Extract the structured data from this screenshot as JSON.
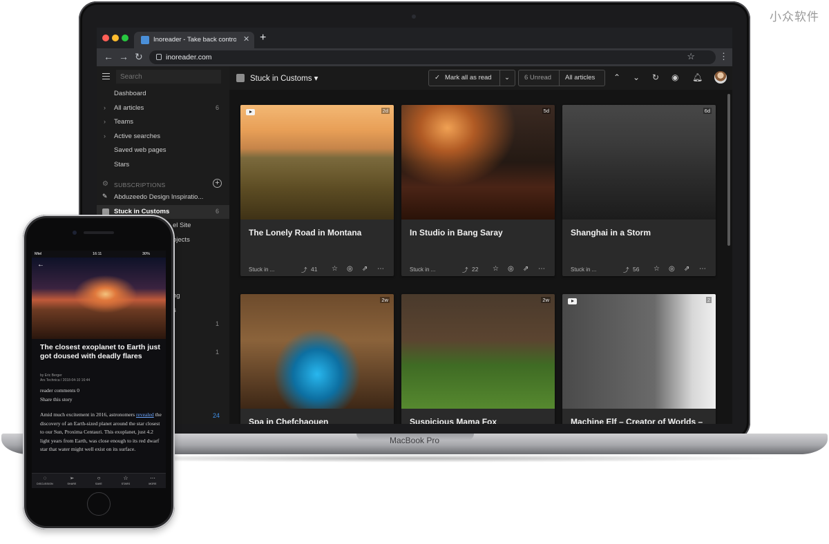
{
  "watermark": "小众软件",
  "laptop": {
    "brand": "MacBook Pro",
    "browser": {
      "tab_title": "Inoreader - Take back control o",
      "url": "inoreader.com"
    },
    "sidebar": {
      "search_placeholder": "Search",
      "nav": [
        {
          "label": "Dashboard",
          "count": ""
        },
        {
          "label": "All articles",
          "count": "6"
        },
        {
          "label": "Teams",
          "count": ""
        },
        {
          "label": "Active searches",
          "count": ""
        },
        {
          "label": "Saved web pages",
          "count": ""
        },
        {
          "label": "Stars",
          "count": ""
        }
      ],
      "subscriptions_heading": "SUBSCRIPTIONS",
      "feeds": [
        {
          "label": "Abduzeedo Design Inspiratio...",
          "count": ""
        },
        {
          "label": "Stuck in Customs",
          "count": "6"
        },
        {
          "label": "el Site",
          "count": ""
        },
        {
          "label": "ojects",
          "count": ""
        },
        {
          "label": "ng",
          "count": ""
        },
        {
          "label": "s",
          "count": ""
        }
      ],
      "extra_counts": [
        "1",
        "1",
        "24"
      ]
    },
    "topbar": {
      "feed_title": "Stuck in Customs ▾",
      "mark_all_read": "Mark all as read",
      "unread": "6 Unread",
      "all_articles": "All articles"
    },
    "cards": [
      {
        "title": "The Lonely Road in Montana",
        "age": "2d",
        "source": "Stuck in ...",
        "popularity": "41",
        "video": true
      },
      {
        "title": "In Studio in Bang Saray",
        "age": "5d",
        "source": "Stuck in ...",
        "popularity": "22",
        "video": false
      },
      {
        "title": "Shanghai in a Storm",
        "age": "6d",
        "source": "Stuck in ...",
        "popularity": "56",
        "video": false
      },
      {
        "title": "Spa in Chefchaouen",
        "age": "2w",
        "source": "",
        "popularity": "",
        "video": false
      },
      {
        "title": "Suspicious Mama Fox",
        "age": "2w",
        "source": "",
        "popularity": "",
        "video": false
      },
      {
        "title": "Machine Elf – Creator of Worlds –",
        "age": "2",
        "source": "",
        "popularity": "",
        "video": true
      }
    ]
  },
  "phone": {
    "status": {
      "carrier": "Mtel",
      "time": "16:11",
      "battery": "30%"
    },
    "title": "The closest exoplanet to Earth just got doused with deadly flares",
    "byline": "by Eric Berger",
    "source_line": "Ars Technica / 2018-04-10 16:44",
    "comments": "reader comments 0",
    "share": "Share this story",
    "body_pre": "Amid much excitement in 2016, astronomers ",
    "body_link": "revealed",
    "body_post": " the discovery of an Earth-sized planet around the star closest to our Sun, Proxima Centauri. This exoplanet, just 4.2 light years from Earth, was close enough to its red dwarf star that water might well exist on its surface.",
    "tabs": [
      "DISCUSSION",
      "SHARE",
      "SAVE",
      "STARS",
      "MORE"
    ]
  }
}
